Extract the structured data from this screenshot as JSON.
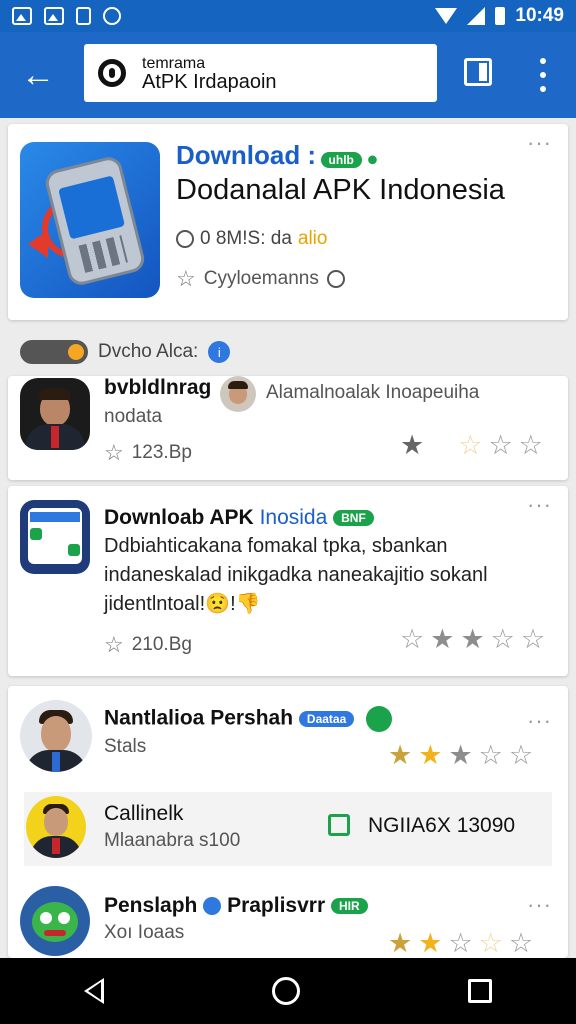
{
  "status_bar": {
    "time": "10:49"
  },
  "app_bar": {
    "url_line1": "temrama",
    "url_line2": "AtPK Irdapaoin"
  },
  "hero": {
    "title": "Download :",
    "badge": "uhlb",
    "name": "Dodanalal APK Indonesia",
    "meta_prefix": "0 8M!S: da",
    "meta_alt": "alio",
    "rating_label": "Cyyloemanns"
  },
  "toggle_row": {
    "label": "Dvcho Alca:",
    "info_glyph": "i"
  },
  "items": [
    {
      "title": "bvbldlnrag",
      "extra": "Alamalnoalak Inoapeuiha",
      "subtitle": "nodata",
      "size": "123.Bp"
    },
    {
      "title_dark": "Downloab APK",
      "title_blue": "Inosida",
      "badge": "BNF",
      "description": "Ddbiahticakana fomakal tpka, sbankan indaneskalad inikgadka naneakajitio sokanl jidentlntoal!😟!👎",
      "size": "210.Bg"
    },
    {
      "title": "Nantlalioa Pershah",
      "badge": "Daataa",
      "subtitle": "Stals"
    },
    {
      "title": "Callinelk",
      "subtitle": "Mlaanabra s100",
      "counter": "NGIIA6X 13090"
    },
    {
      "title": "Penslaph",
      "title_verified": "Praplisvrr",
      "badge": "HIR",
      "subtitle": "Xoı Ioaas"
    }
  ],
  "icons": {
    "star_filled": "★",
    "star_empty": "☆",
    "back_arrow": "←",
    "overflow": "···"
  },
  "colors": {
    "primary": "#1e68c8",
    "accent_green": "#1aa34a",
    "star_gold": "#f2b21b"
  }
}
